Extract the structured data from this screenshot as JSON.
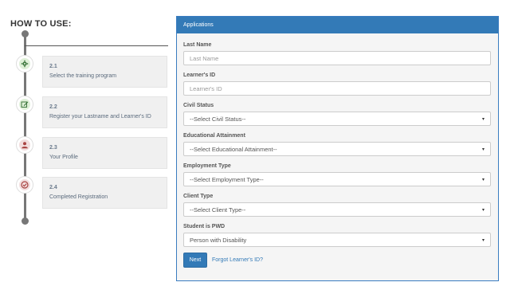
{
  "how_to_use": {
    "title": "HOW TO USE:",
    "steps": [
      {
        "number": "2.1",
        "text": "Select the training program",
        "icon": "gear-icon",
        "color": "#3c763d"
      },
      {
        "number": "2.2",
        "text": "Register your Lastname and Learner's ID",
        "icon": "edit-icon",
        "color": "#3c763d"
      },
      {
        "number": "2.3",
        "text": "Your Profile",
        "icon": "user-icon",
        "color": "#a94442"
      },
      {
        "number": "2.4",
        "text": "Completed Registration",
        "icon": "check-circle-icon",
        "color": "#a94442"
      }
    ]
  },
  "applications": {
    "title": "Applications",
    "last_name": {
      "label": "Last Name",
      "placeholder": "Last Name",
      "value": ""
    },
    "learner_id": {
      "label": "Learner's ID",
      "placeholder": "Learner's ID",
      "value": ""
    },
    "civil_status": {
      "label": "Civil Status",
      "selected": "--Select Civil Status--"
    },
    "educational_attainment": {
      "label": "Educational Attainment",
      "selected": "--Select Educational Attainment--"
    },
    "employment_type": {
      "label": "Employment Type",
      "selected": "--Select Employment Type--"
    },
    "client_type": {
      "label": "Client Type",
      "selected": "--Select Client Type--"
    },
    "student_is_pwd": {
      "label": "Student is PWD",
      "selected": "Person with Disability"
    },
    "next_label": "Next",
    "forgot_label": "Forgot Learner's ID?",
    "caret": "▾"
  },
  "colors": {
    "accent": "#337ab7",
    "step_green_bg": "#dff0d8",
    "step_red_bg": "#f2dede"
  }
}
